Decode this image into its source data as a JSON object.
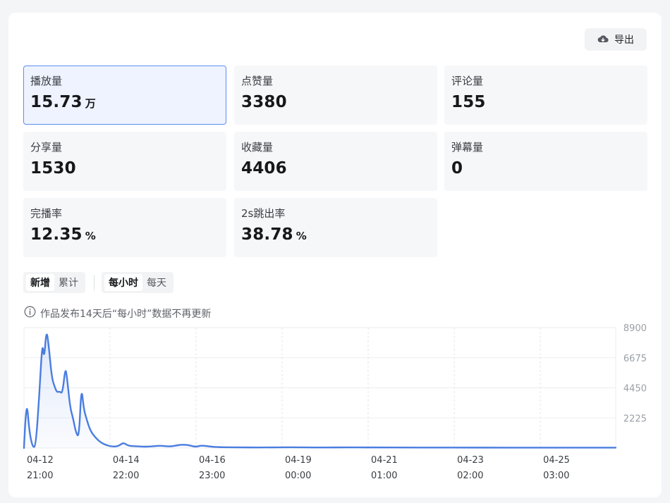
{
  "toolbar": {
    "export_label": "导出",
    "export_icon": "cloud-download-icon"
  },
  "metrics": [
    {
      "label": "播放量",
      "value": "15.73",
      "unit": "万",
      "active": true
    },
    {
      "label": "点赞量",
      "value": "3380",
      "unit": ""
    },
    {
      "label": "评论量",
      "value": "155",
      "unit": ""
    },
    {
      "label": "分享量",
      "value": "1530",
      "unit": ""
    },
    {
      "label": "收藏量",
      "value": "4406",
      "unit": ""
    },
    {
      "label": "弹幕量",
      "value": "0",
      "unit": ""
    },
    {
      "label": "完播率",
      "value": "12.35",
      "unit": "%"
    },
    {
      "label": "2s跳出率",
      "value": "38.78",
      "unit": "%"
    }
  ],
  "mode_toggle": {
    "options": [
      "新增",
      "累计"
    ],
    "selected": "新增"
  },
  "granularity_toggle": {
    "options": [
      "每小时",
      "每天"
    ],
    "selected": "每小时"
  },
  "notice": {
    "icon": "info-icon",
    "text": "作品发布14天后“每小时”数据不再更新"
  },
  "colors": {
    "accent": "#4a7de0",
    "active_border": "#5b8ef0",
    "active_bg": "#eef3ff"
  },
  "chart_data": {
    "type": "area",
    "y_ticks": [
      "8900",
      "6675",
      "4450",
      "2225"
    ],
    "ylim": [
      0,
      8900
    ],
    "x_ticks": [
      {
        "date": "04-12",
        "time": "21:00"
      },
      {
        "date": "04-14",
        "time": "22:00"
      },
      {
        "date": "04-16",
        "time": "23:00"
      },
      {
        "date": "04-19",
        "time": "00:00"
      },
      {
        "date": "04-21",
        "time": "01:00"
      },
      {
        "date": "04-23",
        "time": "02:00"
      },
      {
        "date": "04-25",
        "time": "03:00"
      }
    ],
    "x_tick_positions": [
      0,
      0.1453,
      0.2908,
      0.4362,
      0.5817,
      0.7272,
      0.8726
    ],
    "series": [
      {
        "points": [
          [
            0.0,
            0
          ],
          [
            0.004,
            3900
          ],
          [
            0.009,
            1200
          ],
          [
            0.015,
            0
          ],
          [
            0.02,
            200
          ],
          [
            0.026,
            4000
          ],
          [
            0.031,
            7900
          ],
          [
            0.034,
            6500
          ],
          [
            0.038,
            8800
          ],
          [
            0.042,
            7500
          ],
          [
            0.047,
            5200
          ],
          [
            0.052,
            4500
          ],
          [
            0.056,
            4100
          ],
          [
            0.06,
            4200
          ],
          [
            0.065,
            4000
          ],
          [
            0.07,
            6000
          ],
          [
            0.073,
            5100
          ],
          [
            0.078,
            3000
          ],
          [
            0.083,
            2200
          ],
          [
            0.088,
            1100
          ],
          [
            0.093,
            800
          ],
          [
            0.097,
            4600
          ],
          [
            0.101,
            2900
          ],
          [
            0.106,
            2100
          ],
          [
            0.112,
            1300
          ],
          [
            0.12,
            800
          ],
          [
            0.13,
            400
          ],
          [
            0.14,
            200
          ],
          [
            0.15,
            100
          ],
          [
            0.16,
            140
          ],
          [
            0.168,
            420
          ],
          [
            0.176,
            160
          ],
          [
            0.19,
            130
          ],
          [
            0.21,
            90
          ],
          [
            0.23,
            190
          ],
          [
            0.245,
            100
          ],
          [
            0.26,
            210
          ],
          [
            0.27,
            260
          ],
          [
            0.28,
            200
          ],
          [
            0.29,
            80
          ],
          [
            0.3,
            200
          ],
          [
            0.315,
            100
          ],
          [
            0.33,
            60
          ],
          [
            0.36,
            50
          ],
          [
            0.4,
            40
          ],
          [
            0.45,
            60
          ],
          [
            0.5,
            40
          ],
          [
            0.55,
            50
          ],
          [
            0.6,
            40
          ],
          [
            0.65,
            40
          ],
          [
            0.7,
            35
          ],
          [
            0.75,
            35
          ],
          [
            0.8,
            30
          ],
          [
            0.85,
            30
          ],
          [
            0.9,
            30
          ],
          [
            0.95,
            30
          ],
          [
            1.0,
            30
          ]
        ]
      }
    ]
  }
}
